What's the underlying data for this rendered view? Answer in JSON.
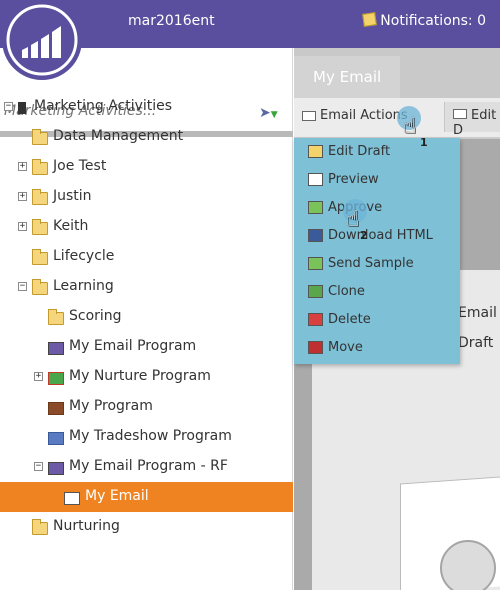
{
  "header": {
    "workspace": "mar2016ent",
    "notifications": "Notifications: 0",
    "brand_color": "#5a4f9e"
  },
  "search": {
    "placeholder": "Marketing Activities..."
  },
  "tree": [
    {
      "label": "Marketing Activities",
      "icon": "marketing-activities-icon",
      "expander": "minus",
      "level": 0
    },
    {
      "label": "Data Management",
      "icon": "folder-icon",
      "expander": "",
      "level": 1
    },
    {
      "label": "Joe Test",
      "icon": "folder-icon",
      "expander": "plus",
      "level": 1
    },
    {
      "label": "Justin",
      "icon": "folder-icon",
      "expander": "plus",
      "level": 1
    },
    {
      "label": "Keith",
      "icon": "folder-icon",
      "expander": "plus",
      "level": 1
    },
    {
      "label": "Lifecycle",
      "icon": "folder-icon",
      "expander": "",
      "level": 1
    },
    {
      "label": "Learning",
      "icon": "folder-icon",
      "expander": "minus",
      "level": 1
    },
    {
      "label": "Scoring",
      "icon": "folder-icon",
      "expander": "",
      "level": 2
    },
    {
      "label": "My Email Program",
      "icon": "email-program-icon",
      "expander": "",
      "level": 2
    },
    {
      "label": "My Nurture Program",
      "icon": "nurture-program-icon",
      "expander": "plus",
      "level": 2
    },
    {
      "label": "My Program",
      "icon": "program-icon",
      "expander": "",
      "level": 2
    },
    {
      "label": "My Tradeshow Program",
      "icon": "tradeshow-program-icon",
      "expander": "",
      "level": 2
    },
    {
      "label": "My Email Program - RF",
      "icon": "email-program-icon",
      "expander": "minus",
      "level": 2
    },
    {
      "label": "My Email",
      "icon": "email-icon",
      "expander": "",
      "level": 3,
      "selected": true
    },
    {
      "label": "Nurturing",
      "icon": "folder-icon",
      "expander": "",
      "level": 1
    }
  ],
  "tabs": {
    "active": "My Email"
  },
  "toolbar": {
    "email_actions": "Email Actions",
    "edit_draft": "Edit D"
  },
  "menu": [
    {
      "label": "Edit Draft",
      "icon": "edit-draft-icon"
    },
    {
      "label": "Preview",
      "icon": "preview-icon"
    },
    {
      "label": "Approve",
      "icon": "approve-icon"
    },
    {
      "label": "Download HTML",
      "icon": "download-html-icon"
    },
    {
      "label": "Send Sample",
      "icon": "send-sample-icon"
    },
    {
      "label": "Clone",
      "icon": "clone-icon"
    },
    {
      "label": "Delete",
      "icon": "delete-icon"
    },
    {
      "label": "Move",
      "icon": "move-icon"
    }
  ],
  "canvas": {
    "snippet1": "Email",
    "snippet2": "Draft"
  },
  "callouts": {
    "step1": "1",
    "step2": "2"
  },
  "colors": {
    "selected": "#f08321",
    "menu_bg": "#7ec0d6"
  }
}
